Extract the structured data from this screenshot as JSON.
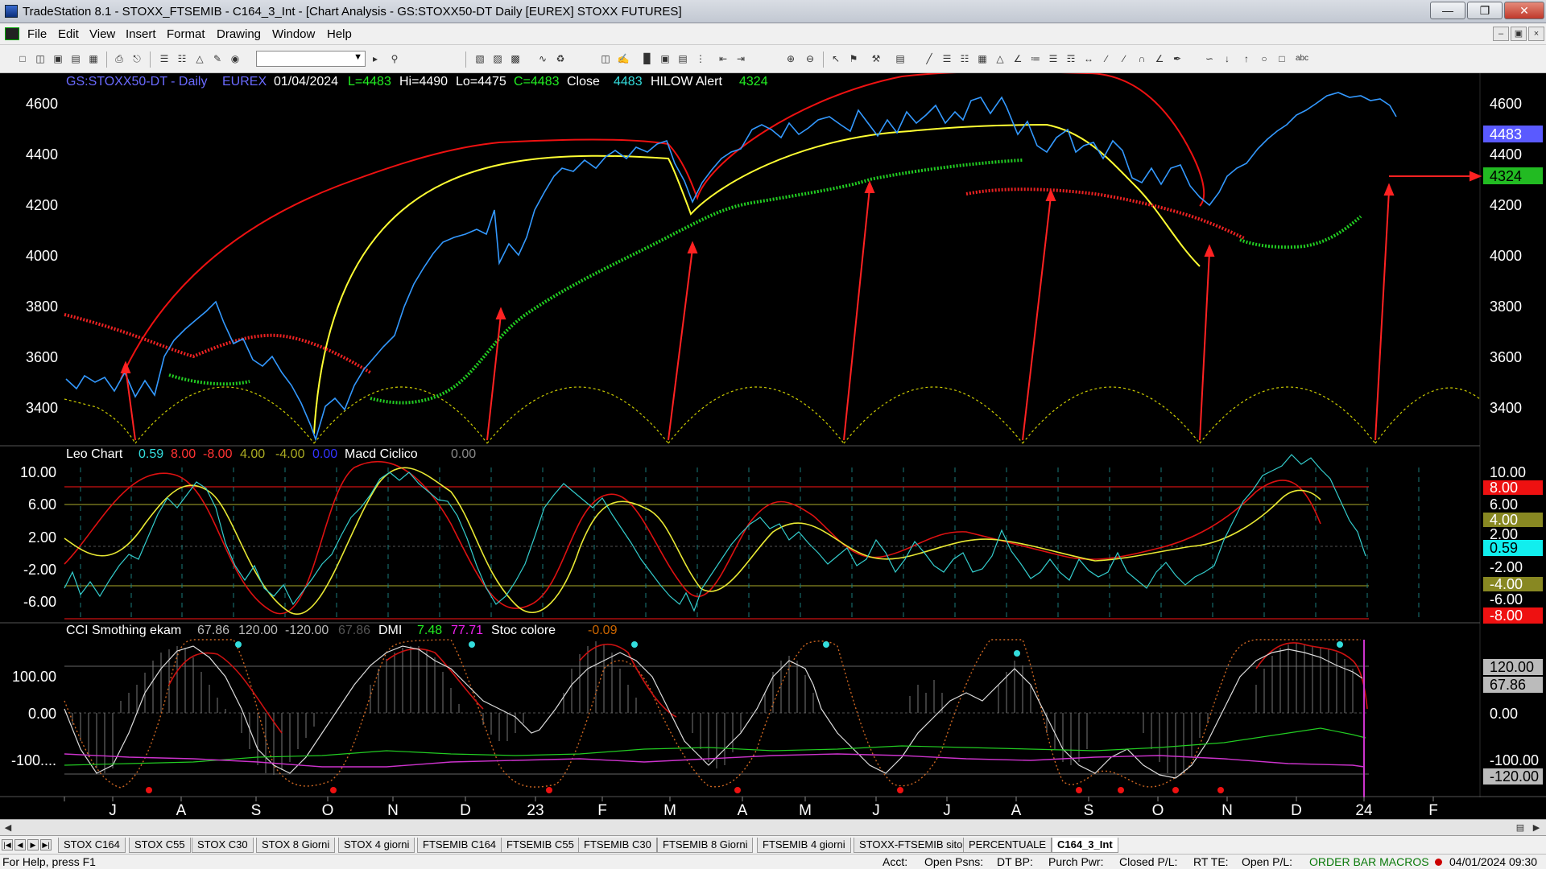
{
  "window": {
    "title": "TradeStation 8.1 - STOXX_FTSEMIB - C164_3_Int - [Chart Analysis - GS:STOXX50-DT  Daily  [EUREX] STOXX FUTURES]"
  },
  "menu": [
    "File",
    "Edit",
    "View",
    "Insert",
    "Format",
    "Drawing",
    "Window",
    "Help"
  ],
  "panes": {
    "price": {
      "header": {
        "symbol": "GS:STOXX50-DT - Daily",
        "exchange": "EUREX",
        "date": "01/04/2024",
        "last": "L=4483",
        "hi": "Hi=4490",
        "lo": "Lo=4475",
        "close": "C=4483",
        "close_label": "Close",
        "close_val": "4483",
        "hilow_label": "HILOW Alert",
        "hilow_val": "4324"
      },
      "axis": [
        "4600",
        "4400",
        "4200",
        "4000",
        "3800",
        "3600",
        "3400"
      ],
      "tag_last": "4483",
      "tag_alert": "4324"
    },
    "leo": {
      "header": {
        "name": "Leo Chart",
        "v1": "0.59",
        "v2": "8.00",
        "v3": "-8.00",
        "v4": "4.00",
        "v5": "-4.00",
        "v6": "0.00",
        "name2": "Macd Ciclico",
        "v7": "0.00"
      },
      "axis": [
        "10.00",
        "6.00",
        "2.00",
        "-2.00",
        "-6.00"
      ],
      "tags": [
        "10.00",
        "8.00",
        "6.00",
        "4.00",
        "2.00",
        "0.59",
        "-2.00",
        "-4.00",
        "-6.00",
        "-8.00"
      ]
    },
    "cci": {
      "header": {
        "name": "CCI Smothing ekam",
        "v1": "67.86",
        "v2": "120.00",
        "v3": "-120.00",
        "v4": "67.86",
        "name2": "DMI",
        "v5": "7.48",
        "v6": "77.71",
        "name3": "Stoc colore",
        "v7": "-0.09"
      },
      "axis": [
        "100.00",
        "0.00",
        "-100...."
      ],
      "tags": [
        "120.00",
        "67.86",
        "0.00",
        "-100.00",
        "-120.00"
      ]
    }
  },
  "x_axis": [
    "J",
    "A",
    "S",
    "O",
    "N",
    "D",
    "23",
    "F",
    "M",
    "A",
    "M",
    "J",
    "J",
    "A",
    "S",
    "O",
    "N",
    "D",
    "24",
    "F"
  ],
  "tabs": [
    "STOX C164",
    "STOX C55",
    "STOX  C30",
    "STOX  8 Giorni",
    "STOX 4 giorni",
    "FTSEMIB C164",
    "FTSEMIB C55",
    "FTSEMIB C30",
    "FTSEMIB  8 Giorni",
    "FTSEMIB  4 giorni",
    "STOXX-FTSEMIB sito",
    "PERCENTUALE",
    "C164_3_Int"
  ],
  "status": {
    "help": "For Help, press F1",
    "acct": "Acct:",
    "open_psns": "Open Psns:",
    "dt_bp": "DT BP:",
    "purch_pwr": "Purch Pwr:",
    "closed_pl": "Closed P/L:",
    "rt_te": "RT TE:",
    "open_pl": "Open P/L:",
    "macros": "ORDER BAR  MACROS",
    "datetime": "04/01/2024 09:30"
  },
  "chart_data": {
    "type": "line",
    "title": "GS:STOXX50-DT - Daily",
    "x": [
      "J",
      "A",
      "S",
      "O",
      "N",
      "D",
      "23",
      "F",
      "M",
      "A",
      "M",
      "J",
      "J",
      "A",
      "S",
      "O",
      "N",
      "D",
      "24"
    ],
    "series": [
      {
        "name": "Close",
        "values": [
          3450,
          3700,
          3500,
          3450,
          3850,
          3980,
          4150,
          4250,
          4300,
          4380,
          4350,
          4420,
          4400,
          4350,
          4200,
          4150,
          4180,
          4560,
          4483
        ]
      },
      {
        "name": "HILOW Alert",
        "values": [
          3600,
          3560,
          3580,
          3470,
          3560,
          3800,
          4000,
          4120,
          4180,
          4240,
          4290,
          4330,
          4380,
          4400,
          4400,
          4300,
          4220,
          4220,
          4324
        ]
      }
    ],
    "ylim": [
      3280,
      4680
    ]
  }
}
